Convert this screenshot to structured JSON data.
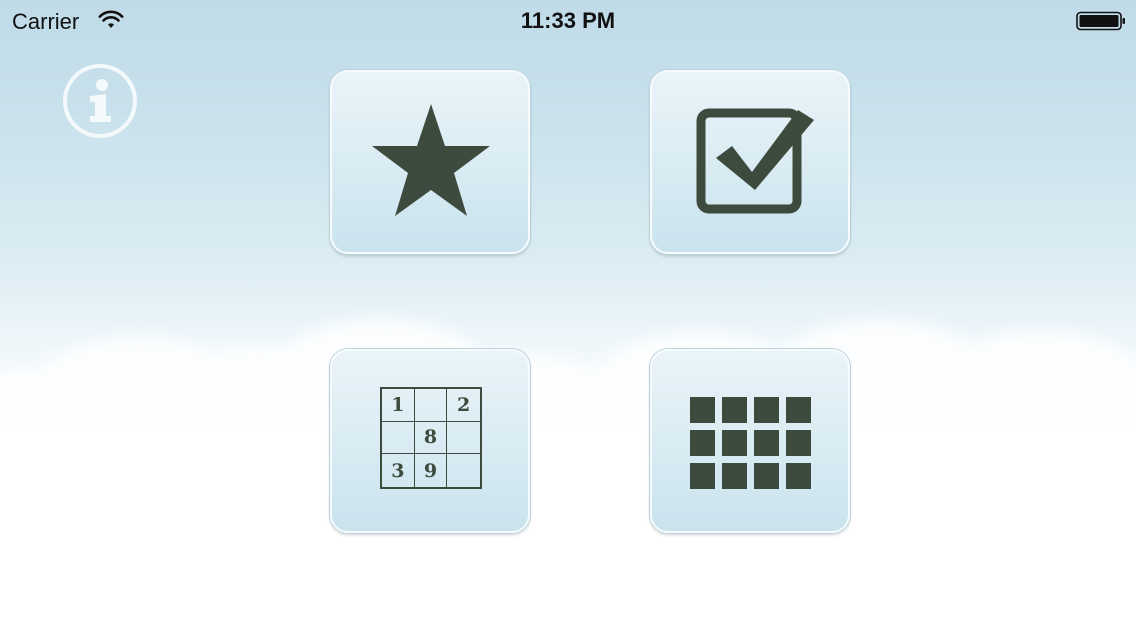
{
  "status_bar": {
    "carrier": "Carrier",
    "time": "11:33 PM",
    "wifi_icon": "wifi-icon",
    "battery_icon": "battery-full-icon"
  },
  "info_button": {
    "icon": "info-icon"
  },
  "menu": {
    "tiles": [
      {
        "icon": "star-icon"
      },
      {
        "icon": "checkbox-checked-icon"
      },
      {
        "icon": "sudoku-grid-icon",
        "cells": [
          "1",
          "",
          "2",
          "",
          "8",
          "",
          "3",
          "9",
          ""
        ]
      },
      {
        "icon": "grid-icon"
      }
    ]
  },
  "colors": {
    "icon_fill": "#3d4a3e",
    "sky_top": "#c0dbe8",
    "tile_bg": "#d8ebf3"
  }
}
